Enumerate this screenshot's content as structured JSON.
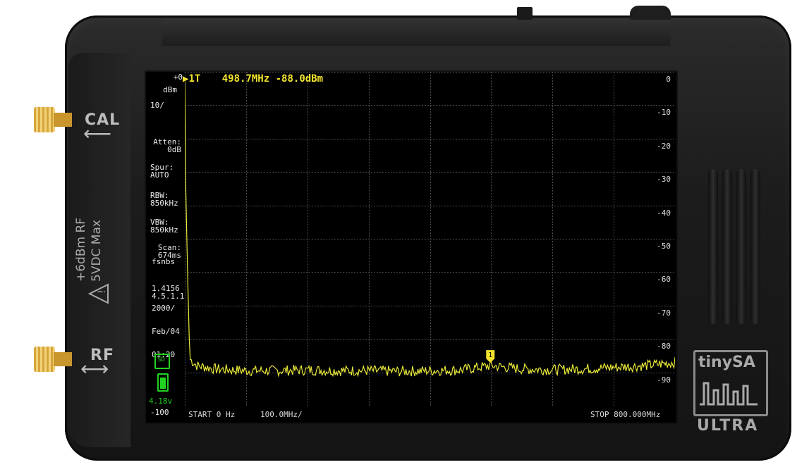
{
  "device": {
    "port_cal": "CAL",
    "port_rf": "RF",
    "side_line1": "+6dBm RF",
    "side_line2": "5VDC Max",
    "logo_name": "tinySA",
    "logo_sub": "ULTRA"
  },
  "screen": {
    "ref_level": "+0",
    "unit": "dBm",
    "scale": "10/",
    "atten_label": "Atten:",
    "atten_value": "0dB",
    "spur_label": "Spur:",
    "spur_value": "AUTO",
    "rbw_label": "RBW:",
    "rbw_value": "850kHz",
    "vbw_label": "VBW:",
    "vbw_value": "850kHz",
    "scan_label": "Scan:",
    "scan_value": "674ms",
    "mode": "fsnbs",
    "version1": "1.4156",
    "version2": "4.5.1.1",
    "date_year": "2000/",
    "date_day": "Feb/04",
    "time": "01:20",
    "sd_label": "SD",
    "battery": "4.18v",
    "bottom_level": "-100",
    "marker_id": "1T",
    "marker_freq": "498.7MHz",
    "marker_level": "-88.0dBm",
    "marker_flag": "1",
    "start": "START 0 Hz",
    "per_div": "100.0MHz/",
    "stop": "STOP 800.000MHz",
    "y_labels": [
      "0",
      "-10",
      "-20",
      "-30",
      "-40",
      "-50",
      "-60",
      "-70",
      "-80",
      "-90"
    ]
  },
  "chart_data": {
    "type": "line",
    "x_unit": "MHz",
    "y_unit": "dBm",
    "xlim": [
      0,
      800
    ],
    "ylim": [
      -100,
      0
    ],
    "series": [
      {
        "x": [
          0,
          2,
          8,
          20,
          50,
          100,
          150,
          200,
          250,
          300,
          350,
          400,
          450,
          498.7,
          550,
          600,
          650,
          700,
          750,
          800
        ],
        "y": [
          -3,
          -40,
          -86,
          -88,
          -89,
          -89.5,
          -89.5,
          -89.3,
          -89.5,
          -89.5,
          -89.7,
          -89.5,
          -89.3,
          -88.0,
          -89.0,
          -89.2,
          -89.0,
          -88.5,
          -88.0,
          -87.0
        ]
      }
    ],
    "marker": {
      "x": 498.7,
      "y": -88.0
    },
    "grid": true
  }
}
